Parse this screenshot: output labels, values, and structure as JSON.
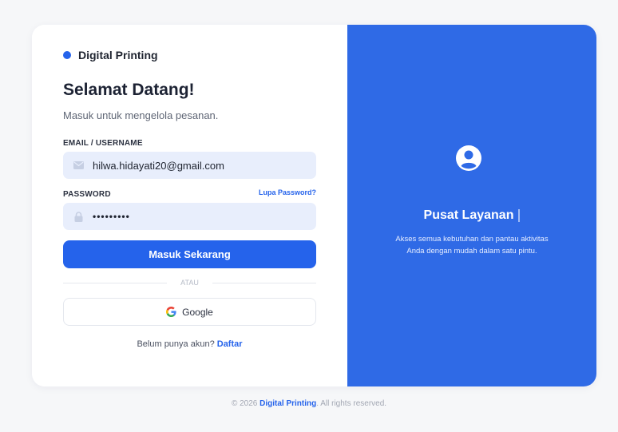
{
  "brand": {
    "name": "Digital Printing"
  },
  "login": {
    "title": "Selamat Datang!",
    "subtitle": "Masuk untuk mengelola pesanan.",
    "email_label": "EMAIL / USERNAME",
    "email_value": "hilwa.hidayati20@gmail.com",
    "password_label": "PASSWORD",
    "forgot_label": "Lupa Password?",
    "password_value": "•••••••••",
    "submit_label": "Masuk Sekarang",
    "divider_label": "ATAU",
    "google_label": "Google",
    "signup_prompt": "Belum punya akun?",
    "signup_link": "Daftar"
  },
  "promo": {
    "title": "Pusat Layanan",
    "description": "Akses semua kebutuhan dan pantau aktivitas Anda dengan mudah dalam satu pintu."
  },
  "footer": {
    "prefix": "© 2026",
    "brand": "Digital Printing",
    "suffix": ". All rights reserved."
  },
  "colors": {
    "accent": "#2563eb",
    "panel": "#2f6ae6",
    "input_bg": "#e8eefc"
  },
  "icons": [
    "mail-icon",
    "lock-icon",
    "google-icon",
    "user-circle-icon"
  ]
}
